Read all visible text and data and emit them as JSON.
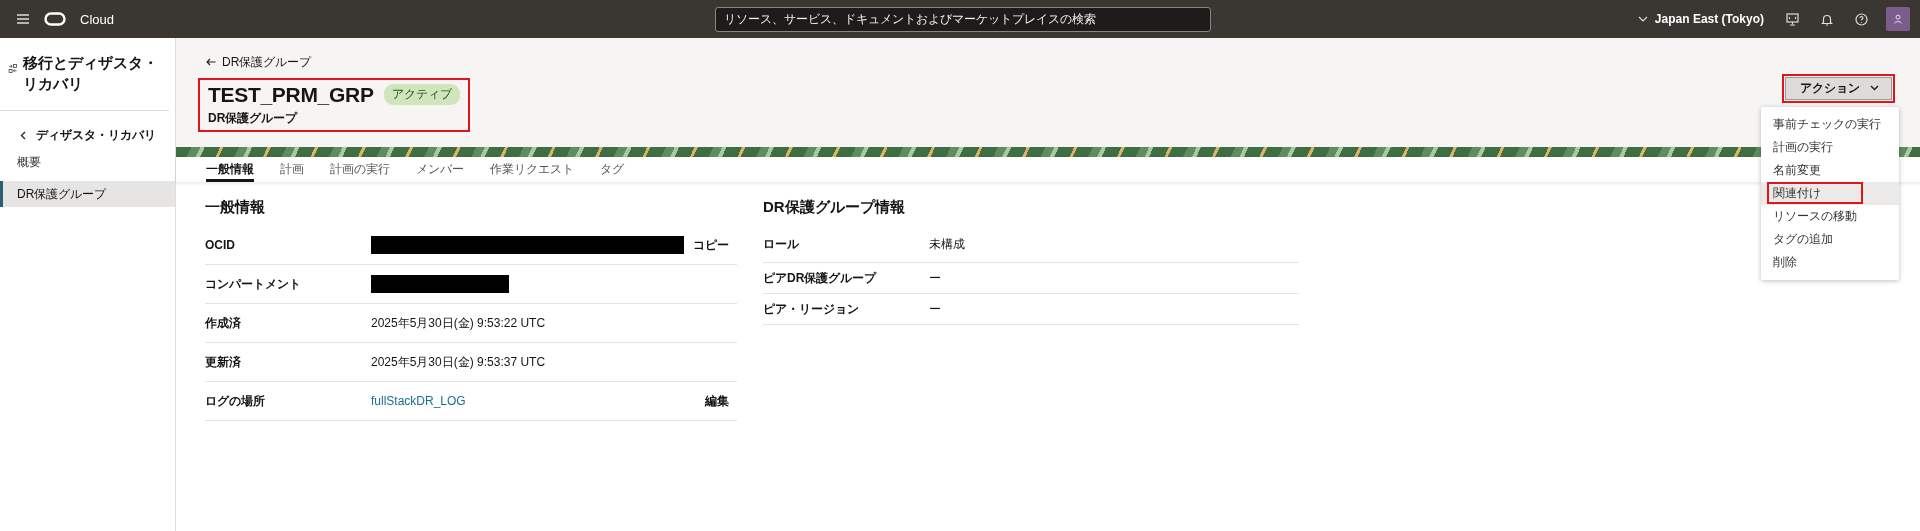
{
  "topbar": {
    "brand": "Cloud",
    "search": {
      "placeholder": "リソース、サービス、ドキュメントおよびマーケットプレイスの検索"
    },
    "region": "Japan East (Tokyo)"
  },
  "sidebar": {
    "title": "移行とディザスタ・リカバリ",
    "back": "ディザスタ・リカバリ",
    "items": [
      {
        "label": "概要",
        "selected": false
      },
      {
        "label": "DR保護グループ",
        "selected": true
      }
    ]
  },
  "header": {
    "back": "DR保護グループ",
    "title": "TEST_PRM_GRP",
    "badge": "アクティブ",
    "subtitle": "DR保護グループ",
    "highlighted": true,
    "actions": {
      "label": "アクション",
      "highlighted": true,
      "expanded": true
    }
  },
  "tabs": [
    {
      "label": "一般情報",
      "selected": true
    },
    {
      "label": "計画",
      "selected": false
    },
    {
      "label": "計画の実行",
      "selected": false
    },
    {
      "label": "メンバー",
      "selected": false
    },
    {
      "label": "作業リクエスト",
      "selected": false
    },
    {
      "label": "タグ",
      "selected": false
    }
  ],
  "general": {
    "heading": "一般情報",
    "rows": [
      {
        "label": "OCID",
        "kind": "redacted",
        "action": "コピー"
      },
      {
        "label": "コンパートメント",
        "kind": "redacted"
      },
      {
        "label": "作成済",
        "kind": "text",
        "value": "2025年5月30日(金) 9:53:22 UTC"
      },
      {
        "label": "更新済",
        "kind": "text",
        "value": "2025年5月30日(金) 9:53:37 UTC"
      },
      {
        "label": "ログの場所",
        "kind": "link",
        "value": "fullStackDR_LOG",
        "action": "編集"
      }
    ]
  },
  "dr_info": {
    "heading": "DR保護グループ情報",
    "rows": [
      {
        "label": "ロール",
        "value": "未構成"
      },
      {
        "label": "ピアDR保護グループ",
        "value": "ー"
      },
      {
        "label": "ピア・リージョン",
        "value": "ー"
      }
    ]
  },
  "action_menu": [
    {
      "label": "事前チェックの実行",
      "selected": false,
      "highlighted": false
    },
    {
      "label": "計画の実行",
      "selected": false,
      "highlighted": false
    },
    {
      "label": "名前変更",
      "selected": false,
      "highlighted": false
    },
    {
      "label": "関連付け",
      "selected": true,
      "highlighted": true
    },
    {
      "label": "リソースの移動",
      "selected": false,
      "highlighted": false
    },
    {
      "label": "タグの追加",
      "selected": false,
      "highlighted": false
    },
    {
      "label": "削除",
      "selected": false,
      "highlighted": false
    }
  ]
}
